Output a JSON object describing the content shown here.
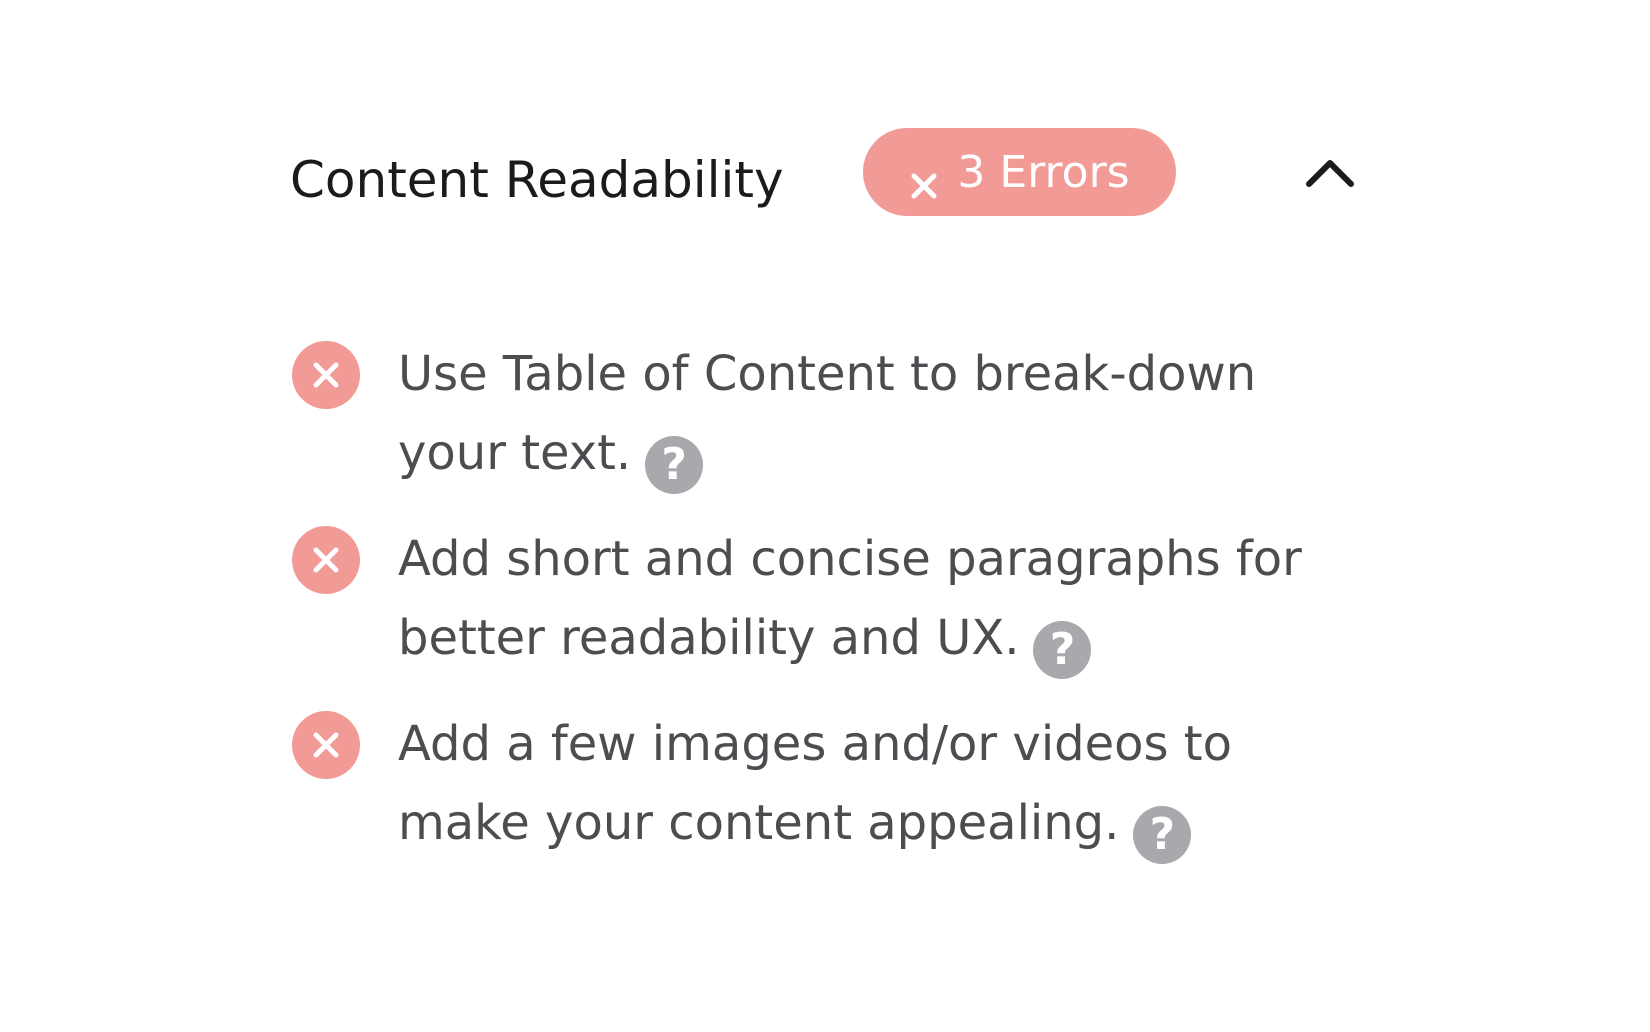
{
  "section": {
    "title": "Content Readability",
    "badge": {
      "label": "3 Errors",
      "icon": "close-icon",
      "color": "#f19a96"
    },
    "toggle_icon": "chevron-up-icon"
  },
  "checklist": [
    {
      "status": "error",
      "status_icon": "error-circle-icon",
      "text": "Use Table of Content to break-down your text.",
      "help": "?"
    },
    {
      "status": "error",
      "status_icon": "error-circle-icon",
      "text": "Add short and concise paragraphs for better readability and UX.",
      "help": "?"
    },
    {
      "status": "error",
      "status_icon": "error-circle-icon",
      "text": "Add a few images and/or videos to make your content appealing.",
      "help": "?"
    }
  ],
  "colors": {
    "error": "#f19a96",
    "help_icon": "#a7a9ac",
    "title_text": "#1b1b1b",
    "item_text": "#4b4d50"
  }
}
